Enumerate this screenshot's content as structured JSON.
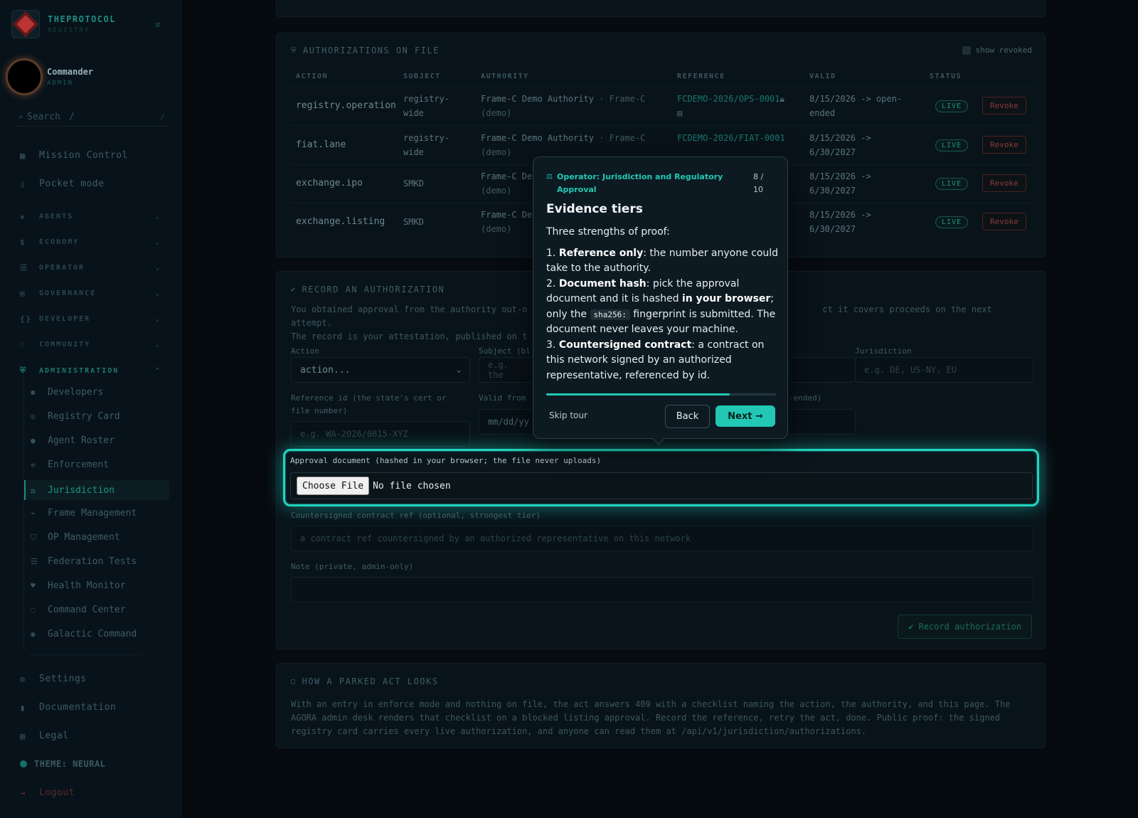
{
  "brand": {
    "name": "THEPROTOCOL",
    "sub": "REGISTRY"
  },
  "user": {
    "name": "Commander",
    "role": "ADMIN"
  },
  "search": {
    "placeholder": "Search",
    "shortcut": "/",
    "shortcut2": "/"
  },
  "nav": {
    "top": [
      "Mission Control",
      "Pocket mode"
    ],
    "groups": [
      "AGENTS",
      "ECONOMY",
      "OPERATOR",
      "GOVERNANCE",
      "DEVELOPER",
      "COMMUNITY",
      "ADMINISTRATION"
    ],
    "admin_items": [
      "Developers",
      "Registry Card",
      "Agent Roster",
      "Enforcement",
      "Jurisdiction",
      "Frame Management",
      "OP Management",
      "Federation Tests",
      "Health Monitor",
      "Command Center",
      "Galactic Command"
    ],
    "bottom": [
      "Settings",
      "Documentation",
      "Legal",
      "THEME: NEURAL",
      "Logout"
    ]
  },
  "auth": {
    "title": "AUTHORIZATIONS ON FILE",
    "show_revoked": "show revoked",
    "headers": [
      "ACTION",
      "SUBJECT",
      "AUTHORITY",
      "REFERENCE",
      "VALID",
      "STATUS"
    ],
    "rows": [
      {
        "action": "registry.operation",
        "subject": "registry-wide",
        "authority": "Frame-C Demo Authority",
        "authority_sub": "· Frame-C (demo)",
        "reference": "FCDEMO-2026/OPS-0001",
        "valid": "8/15/2026 -> open-ended",
        "status": "LIVE",
        "revoke": "Revoke"
      },
      {
        "action": "fiat.lane",
        "subject": "registry-wide",
        "authority": "Frame-C Demo Authority",
        "authority_sub": "· Frame-C (demo)",
        "reference": "FCDEMO-2026/FIAT-0001",
        "valid": "8/15/2026 -> 6/30/2027",
        "status": "LIVE",
        "revoke": "Revoke"
      },
      {
        "action": "exchange.ipo",
        "subject": "SMKD",
        "authority": "Frame-C De",
        "authority_sub": "(demo)",
        "reference": "",
        "valid": "8/15/2026 -> 6/30/2027",
        "status": "LIVE",
        "revoke": "Revoke"
      },
      {
        "action": "exchange.listing",
        "subject": "SMKD",
        "authority": "Frame-C De",
        "authority_sub": "(demo)",
        "reference": "",
        "valid": "8/15/2026 -> 6/30/2027",
        "status": "LIVE",
        "revoke": "Revoke"
      }
    ]
  },
  "record": {
    "title": "RECORD AN AUTHORIZATION",
    "desc_line1a": "You obtained approval from the authority out-o",
    "desc_line1b": "ct it covers proceeds on the next attempt.",
    "desc_line2": "The record is your attestation, published on t",
    "action_label": "Action",
    "action_value": "action...",
    "subject_label": "Subject (bl",
    "subject_placeholder": "e.g. the",
    "jurisdiction_label": "Jurisdiction",
    "jurisdiction_placeholder": "e.g. DE, US-NY, EU",
    "reference_label": "Reference id (the state's cert or file number)",
    "reference_placeholder": "e.g. WA-2026/0815-XYZ",
    "valid_label": "Valid from",
    "valid_placeholder": "mm/dd/yy",
    "valid_to_label": "-ended)",
    "doc_label": "Approval document (hashed in your browser; the file never uploads)",
    "choose_file": "Choose File",
    "no_file": "No file chosen",
    "contract_label": "Countersigned contract ref (optional, strongest tier)",
    "contract_placeholder": "a contract ref countersigned by an authorized representative on this network",
    "note_label": "Note (private, admin-only)",
    "submit": "Record authorization"
  },
  "parked": {
    "title": "HOW A PARKED ACT LOOKS",
    "text": "With an entry in enforce mode and nothing on file, the act answers 409 with a checklist naming the action, the authority, and this page. The AGORA admin desk renders that checklist on a blocked listing approval. Record the reference, retry the act, done. Public proof: the signed registry card carries every live authorization, and anyone can read them at /api/v1/jurisdiction/authorizations."
  },
  "tour": {
    "kicker": "Operator: Jurisdiction and Regulatory Approval",
    "step": "8 / 10",
    "title": "Evidence tiers",
    "intro": "Three strengths of proof:",
    "t1_bold": "Reference only",
    "t1_rest": ": the number anyone could take to the authority.",
    "t2_bold": "Document hash",
    "t2_rest_a": ": pick the approval document and it is hashed ",
    "t2_bold2": "in your browser",
    "t2_rest_b": "; only the ",
    "t2_code": "sha256:",
    "t2_rest_c": " fingerprint is submitted. The document never leaves your machine.",
    "t3_bold": "Countersigned contract",
    "t3_rest": ": a contract on this network signed by an authorized representative, referenced by id.",
    "progress": 0.8,
    "skip": "Skip tour",
    "back": "Back",
    "next": "Next →"
  }
}
